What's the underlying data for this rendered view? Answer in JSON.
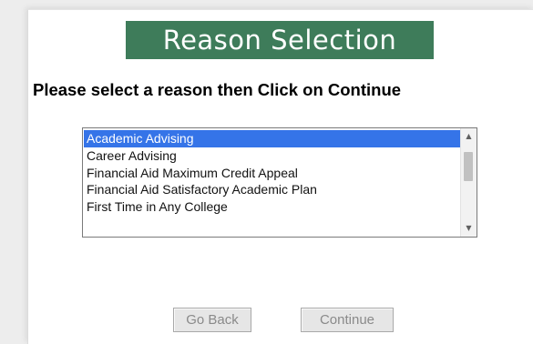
{
  "banner": {
    "title": "Reason Selection",
    "color": "#3e7c5a"
  },
  "instruction": "Please select a reason then Click on Continue",
  "reason_list": {
    "selected_index": 0,
    "options": [
      "Academic Advising",
      "Career Advising",
      "Financial Aid Maximum Credit Appeal",
      "Financial Aid Satisfactory Academic Plan",
      "First Time in Any College"
    ],
    "highlight_color": "#3574e8"
  },
  "buttons": {
    "back": "Go Back",
    "continue": "Continue"
  }
}
